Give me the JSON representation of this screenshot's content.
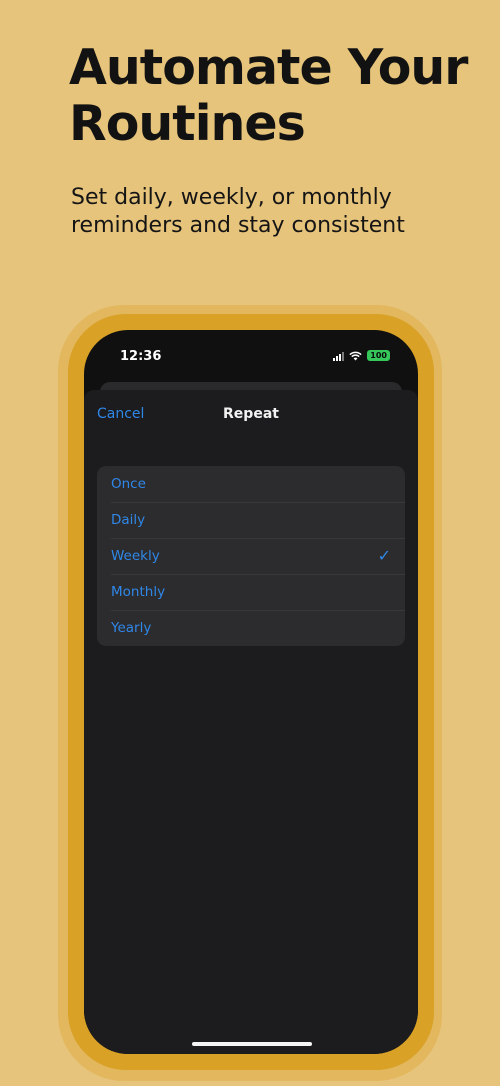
{
  "promo": {
    "headline": "Automate Your Routines",
    "subhead": "Set daily, weekly, or monthly reminders and stay consistent"
  },
  "status_bar": {
    "time": "12:36",
    "battery": "100",
    "icons": [
      "signal-icon",
      "wifi-icon",
      "battery-icon"
    ]
  },
  "sheet": {
    "cancel_label": "Cancel",
    "title": "Repeat",
    "options": [
      {
        "label": "Once"
      },
      {
        "label": "Daily"
      },
      {
        "label": "Weekly",
        "selected": true
      },
      {
        "label": "Monthly"
      },
      {
        "label": "Yearly"
      }
    ],
    "checkmark": "✓"
  },
  "colors": {
    "background": "#e7c47b",
    "device_frame": "#d9a126",
    "accent": "#2f87e8",
    "battery_green": "#35c759"
  }
}
